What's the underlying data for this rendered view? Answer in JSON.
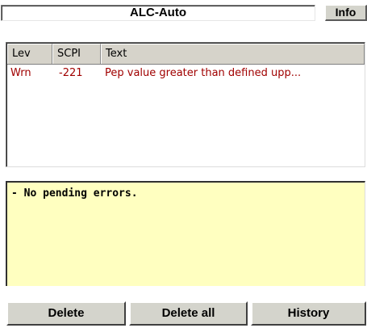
{
  "status": {
    "title": "ALC-Auto",
    "info_label": "Info"
  },
  "error_table": {
    "columns": [
      "Lev",
      "SCPI",
      "Text"
    ],
    "rows": [
      {
        "lev": "Wrn",
        "scpi": "-221",
        "text": "Pep value greater than defined upp..."
      }
    ]
  },
  "message_panel": {
    "text": "- No pending errors."
  },
  "buttons": {
    "delete": "Delete",
    "delete_all": "Delete all",
    "history": "History"
  },
  "colors": {
    "error_text": "#a00000",
    "message_background": "#ffffc0",
    "button_face": "#d4d4cc"
  }
}
